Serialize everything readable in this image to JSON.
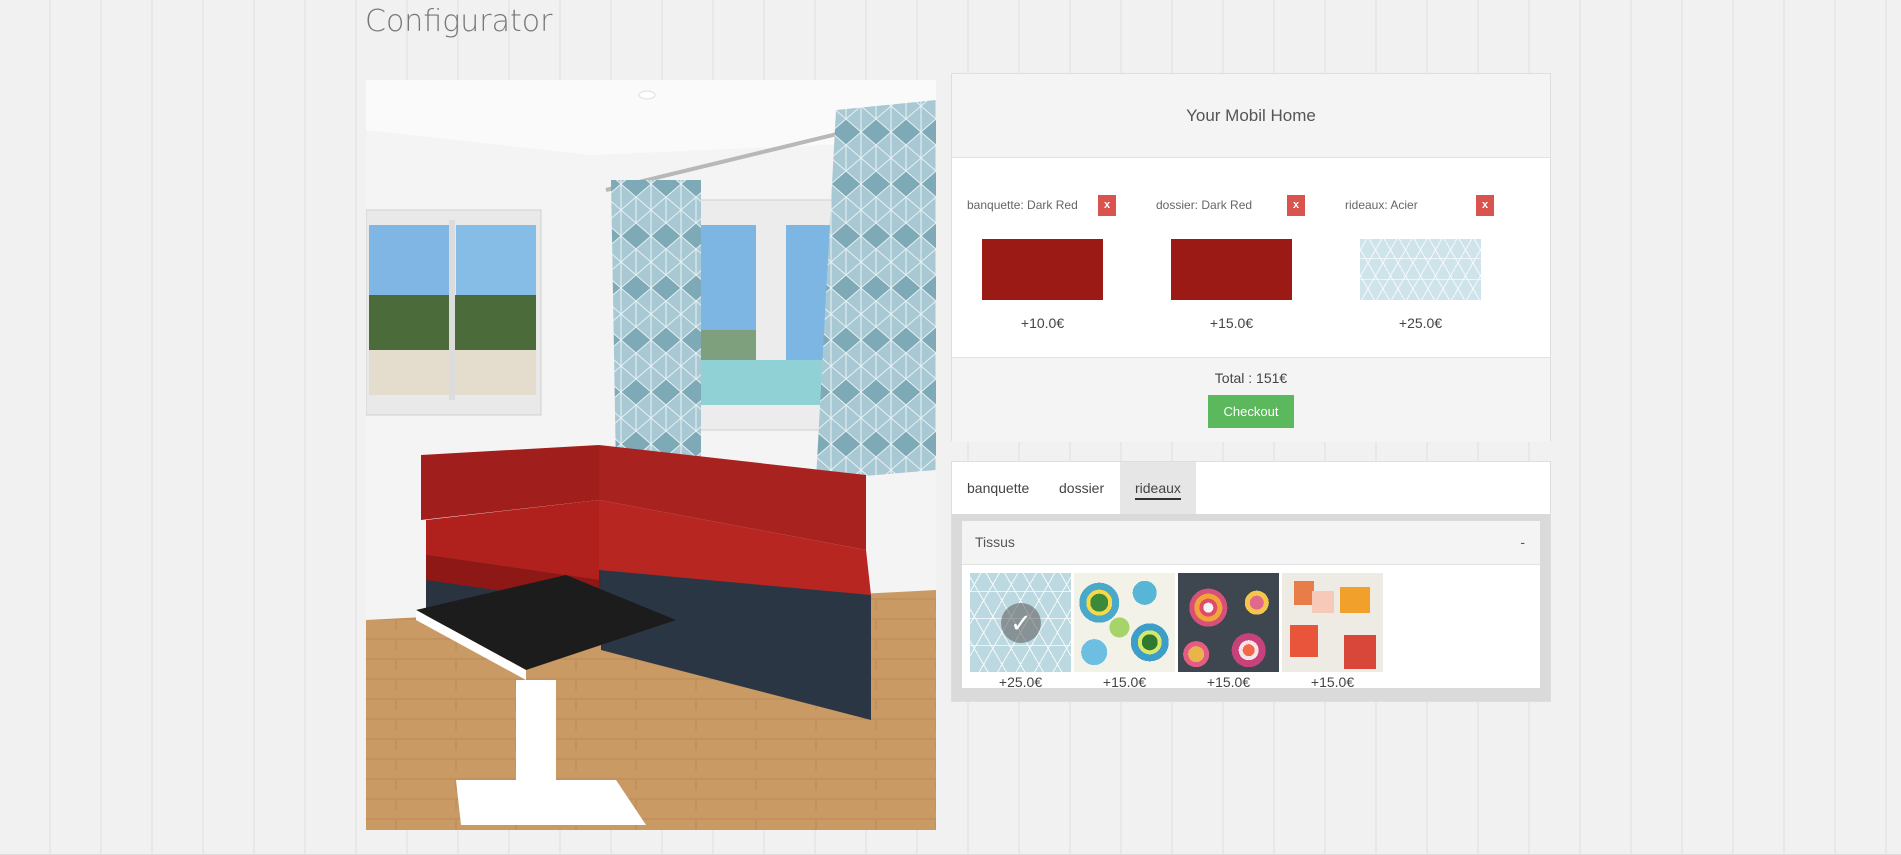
{
  "page": {
    "title": "Configurator"
  },
  "summary": {
    "header": "Your Mobil Home",
    "items": [
      {
        "label": "banquette: Dark Red",
        "remove": "x",
        "price": "+10.0€",
        "swatch": "dark-red"
      },
      {
        "label": "dossier: Dark Red",
        "remove": "x",
        "price": "+15.0€",
        "swatch": "dark-red"
      },
      {
        "label": "rideaux: Acier",
        "remove": "x",
        "price": "+25.0€",
        "swatch": "acier-pattern"
      }
    ],
    "total": "Total : 151€",
    "checkout_label": "Checkout"
  },
  "tabs": {
    "items": [
      {
        "label": "banquette",
        "active": false
      },
      {
        "label": "dossier",
        "active": false
      },
      {
        "label": "rideaux",
        "active": true
      }
    ]
  },
  "fabrics": {
    "title": "Tissus",
    "toggle": "-",
    "items": [
      {
        "price": "+25.0€",
        "pattern": "geometric-blue",
        "selected": true
      },
      {
        "price": "+15.0€",
        "pattern": "green-circles",
        "selected": false
      },
      {
        "price": "+15.0€",
        "pattern": "mandala",
        "selected": false
      },
      {
        "price": "+15.0€",
        "pattern": "red-squares",
        "selected": false
      }
    ]
  },
  "colors": {
    "accent_remove": "#d9534f",
    "checkout": "#5cb85c",
    "dark_red": "#9c1a16"
  }
}
